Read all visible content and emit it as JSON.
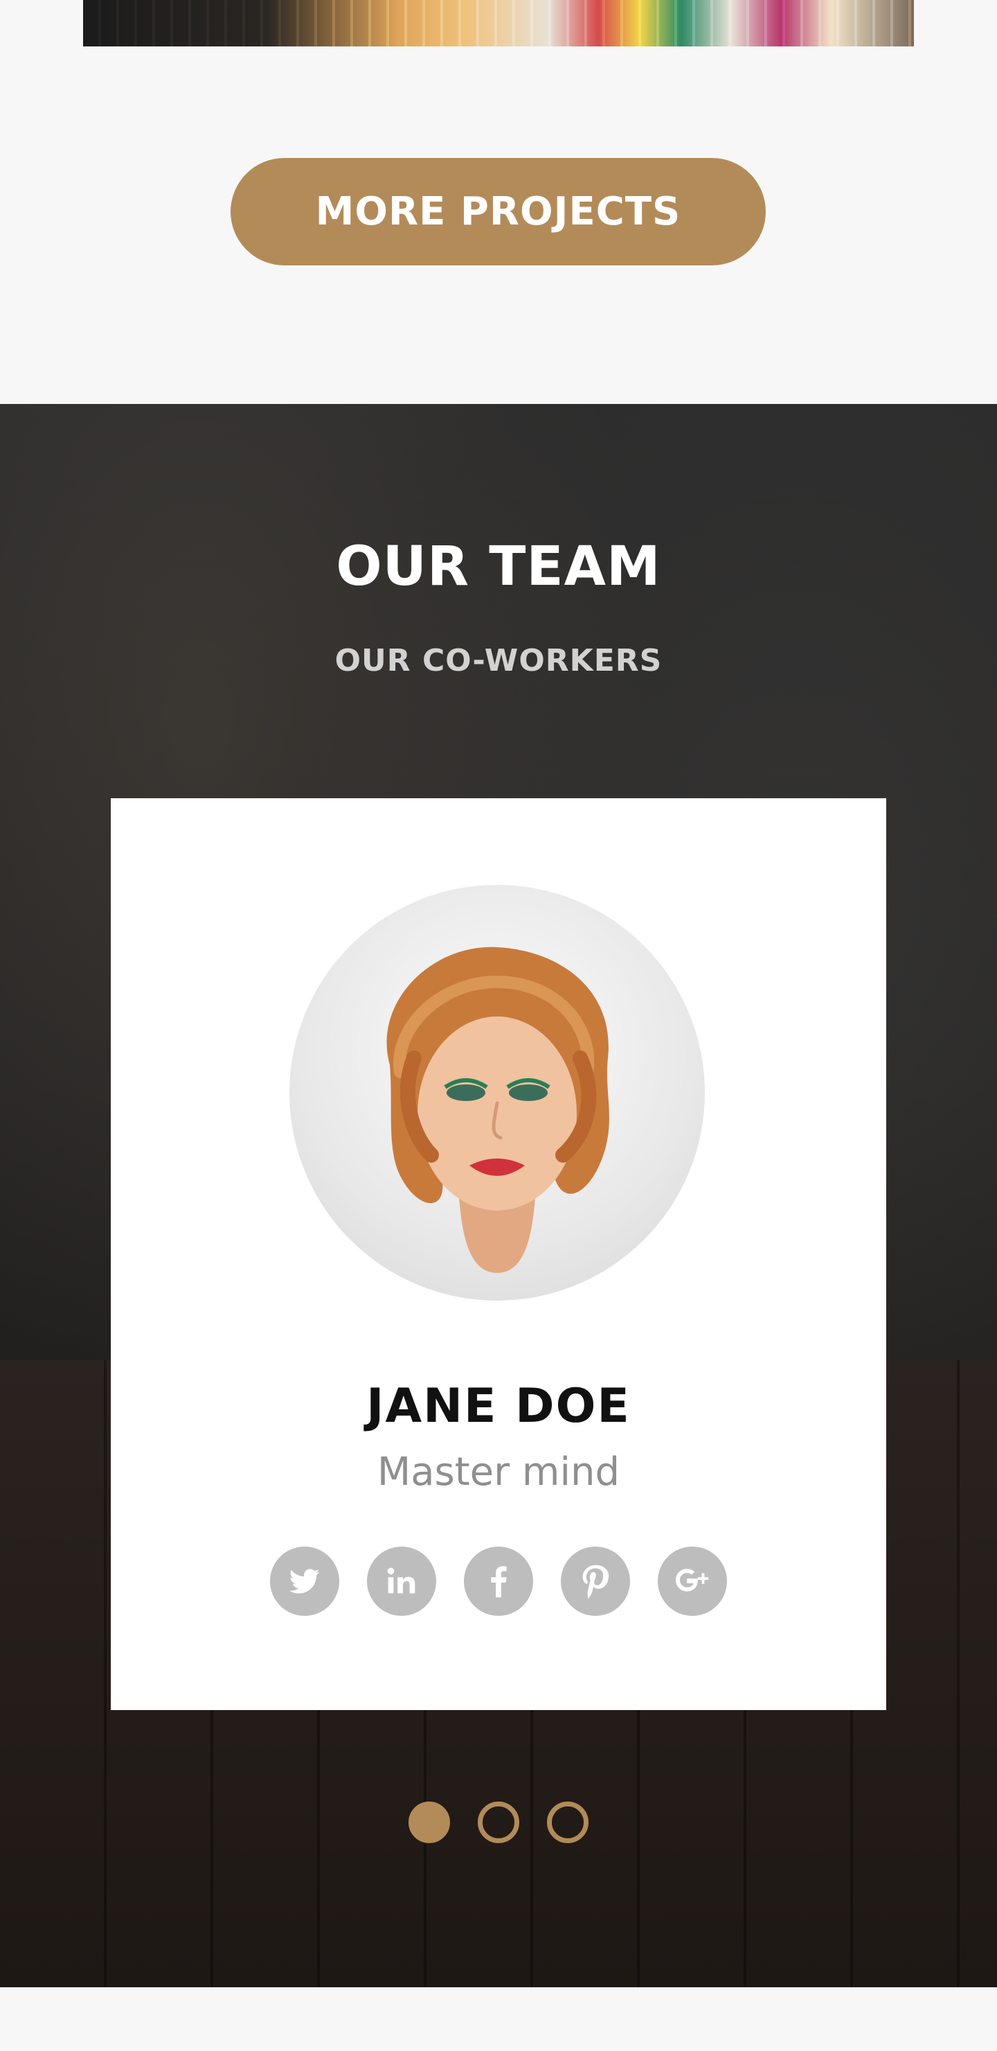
{
  "projects": {
    "more_button_label": "MORE PROJECTS"
  },
  "team": {
    "title": "OUR TEAM",
    "subtitle": "OUR CO-WORKERS",
    "members": [
      {
        "name": "JANE DOE",
        "role": "Master mind",
        "social_links": [
          {
            "icon": "twitter-icon"
          },
          {
            "icon": "linkedin-icon"
          },
          {
            "icon": "facebook-icon"
          },
          {
            "icon": "pinterest-icon"
          },
          {
            "icon": "google-plus-icon"
          }
        ]
      }
    ],
    "carousel": {
      "total": 3,
      "active_index": 0
    }
  },
  "colors": {
    "accent": "#b38b59",
    "social_icon_bg": "#bdbdbd",
    "dark_section_bg": "#262524",
    "card_bg": "#ffffff",
    "page_bg": "#f7f7f7"
  }
}
